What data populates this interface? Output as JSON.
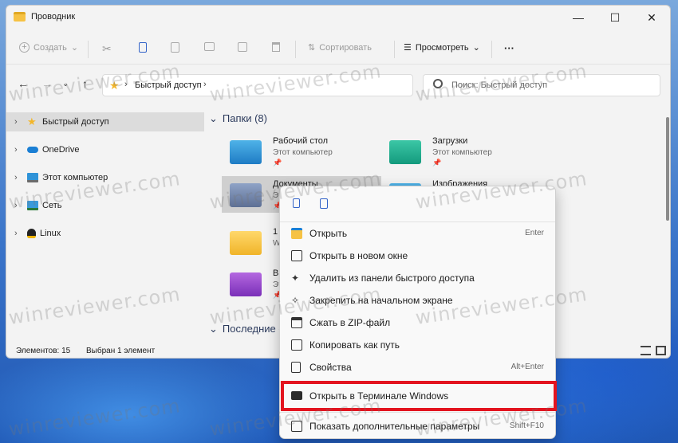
{
  "window": {
    "title": "Проводник",
    "minimize": "—",
    "maximize": "☐",
    "close": "✕"
  },
  "toolbar": {
    "create": "Создать",
    "sort": "Сортировать",
    "view": "Просмотреть",
    "more": "···"
  },
  "address": {
    "crumb": "Быстрый доступ",
    "search_placeholder": "Поиск: Быстрый доступ"
  },
  "sidebar": {
    "items": [
      {
        "label": "Быстрый доступ",
        "icon": "star-icon"
      },
      {
        "label": "OneDrive",
        "icon": "cloud-icon"
      },
      {
        "label": "Этот компьютер",
        "icon": "computer-icon"
      },
      {
        "label": "Сеть",
        "icon": "network-icon"
      },
      {
        "label": "Linux",
        "icon": "linux-icon"
      }
    ]
  },
  "content": {
    "folders_header": "Папки (8)",
    "recent_header": "Последние ф",
    "tiles": [
      {
        "name": "Рабочий стол",
        "sub": "Этот компьютер",
        "pin": "📌"
      },
      {
        "name": "Загрузки",
        "sub": "Этот компьютер",
        "pin": "📌"
      },
      {
        "name": "Документы",
        "sub": "Это",
        "pin": "📌"
      },
      {
        "name": "Изображения",
        "sub": "",
        "pin": ""
      },
      {
        "name": "1",
        "sub": "Win",
        "pin": ""
      },
      {
        "name": "Вид",
        "sub": "Это",
        "pin": "📌"
      }
    ]
  },
  "status": {
    "items": "Элементов: 15",
    "selected": "Выбран 1 элемент"
  },
  "menu": {
    "items": [
      {
        "label": "Открыть",
        "shortcut": "Enter"
      },
      {
        "label": "Открыть в новом окне",
        "shortcut": ""
      },
      {
        "label": "Удалить из панели быстрого доступа",
        "shortcut": ""
      },
      {
        "label": "Закрепить на начальном экране",
        "shortcut": ""
      },
      {
        "label": "Сжать в ZIP-файл",
        "shortcut": ""
      },
      {
        "label": "Копировать как путь",
        "shortcut": ""
      },
      {
        "label": "Свойства",
        "shortcut": "Alt+Enter"
      },
      {
        "label": "Открыть в Терминале Windows",
        "shortcut": ""
      },
      {
        "label": "Показать дополнительные параметры",
        "shortcut": "Shift+F10"
      }
    ]
  },
  "watermark": "winreviewer.com",
  "colors": {
    "highlight": "#e3141f",
    "accent": "#1a7fd4",
    "folder_yellow": "#f6c244"
  }
}
